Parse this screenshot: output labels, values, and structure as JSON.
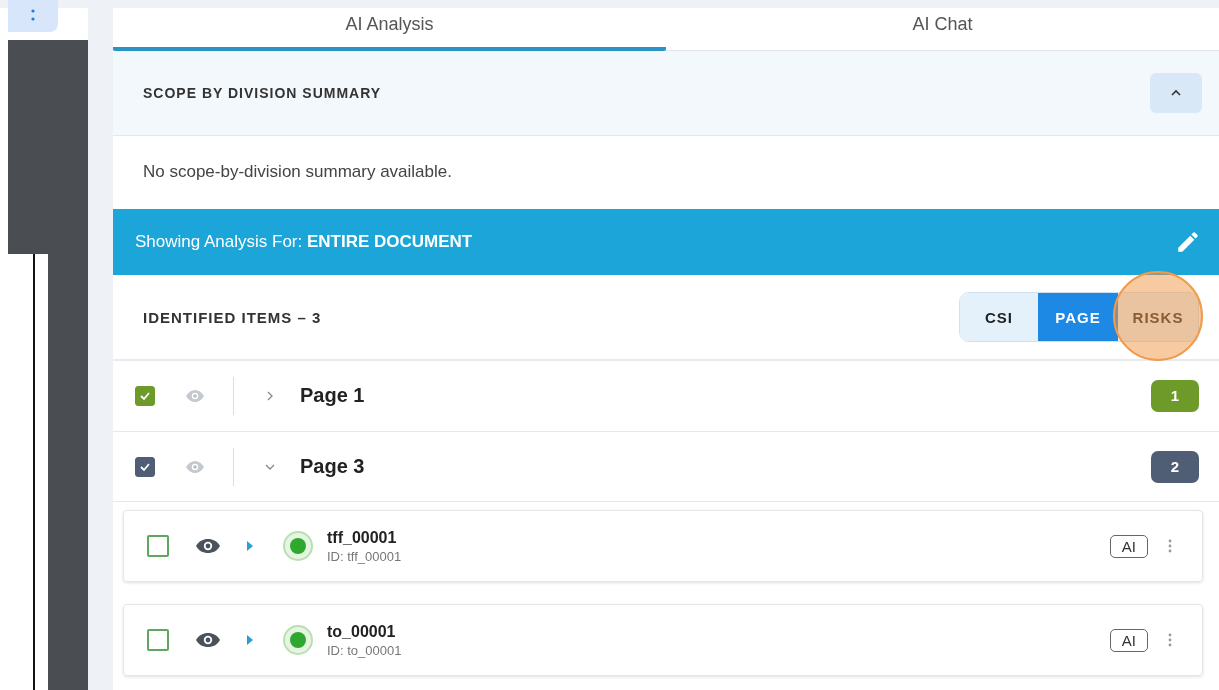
{
  "tabs": [
    {
      "label": "AI Analysis",
      "selected": true
    },
    {
      "label": "AI Chat",
      "selected": false
    }
  ],
  "summary": {
    "title": "SCOPE BY DIVISION SUMMARY",
    "expanded": true,
    "text": "No scope-by-division summary available."
  },
  "analysis_bar": {
    "text": "Showing Analysis For: **ENTIRE DOCUMENT**"
  },
  "identified": {
    "title": "IDENTIFIED ITEMS – 3",
    "views": [
      {
        "label": "CSI",
        "selected": false
      },
      {
        "label": "PAGE",
        "selected": true
      },
      {
        "label": "RISKS",
        "selected": false,
        "highlighted": true
      }
    ]
  },
  "groups": [
    {
      "label": "Page 1",
      "checked": true,
      "expanded": false,
      "count": "1",
      "color": "#6e9a2a"
    },
    {
      "label": "Page 3",
      "checked": true,
      "expanded": true,
      "count": "2",
      "color": "#4f5d75",
      "items": [
        {
          "name": "tff_00001",
          "id": "ID: tff_00001",
          "checked": false,
          "color": "#2ea82e",
          "tag": "AI"
        },
        {
          "name": "to_00001",
          "id": "ID: to_00001",
          "checked": false,
          "color": "#2ea82e",
          "tag": "AI"
        }
      ]
    }
  ]
}
